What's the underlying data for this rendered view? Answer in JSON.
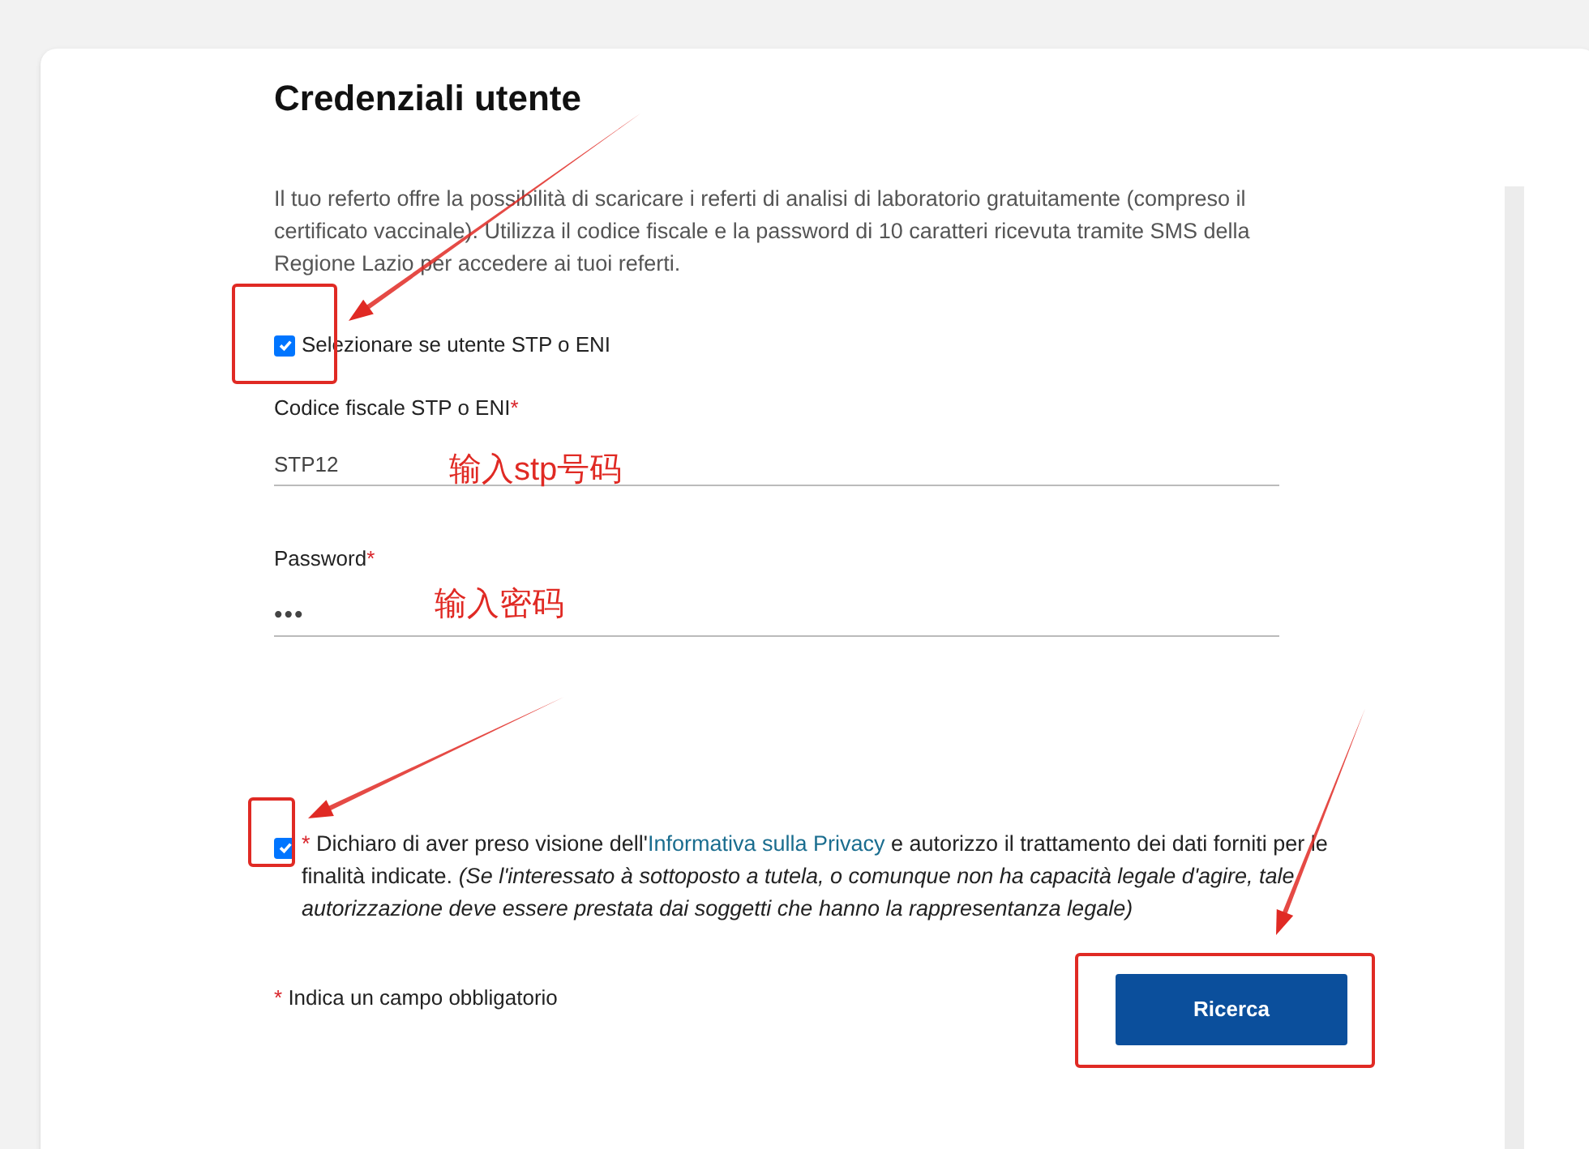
{
  "title": "Credenziali utente",
  "intro": "Il tuo referto offre la possibilità di scaricare i referti di analisi di laboratorio gratuitamente (compreso il certificato vaccinale). Utilizza il codice fiscale e la password di 10 caratteri ricevuta tramite SMS della Regione Lazio per accedere ai tuoi referti.",
  "required_mark": "*",
  "stp_checkbox": {
    "label": "Selezionare se utente STP o ENI",
    "checked": true
  },
  "fields": [
    {
      "label": "Codice fiscale STP o ENI",
      "required": true,
      "value": "STP12",
      "kind": "text"
    },
    {
      "label": "Password",
      "required": true,
      "value": "•••",
      "kind": "password"
    }
  ],
  "consent": {
    "checked": true,
    "required": true,
    "before": "Dichiaro di aver preso visione dell'",
    "link": "Informativa sulla Privacy",
    "after": " e autorizzo il trattamento dei dati forniti per le finalità indicate. ",
    "note": "(Se l'interessato à sottoposto a tutela, o comunque non ha capacità legale d'agire, tale autorizzazione deve essere prestata dai soggetti che hanno la rappresentanza legale)"
  },
  "required_note": "Indica un campo obbligatorio",
  "button": "Ricerca",
  "annotations": [
    "输入stp号码",
    "输入密码"
  ]
}
